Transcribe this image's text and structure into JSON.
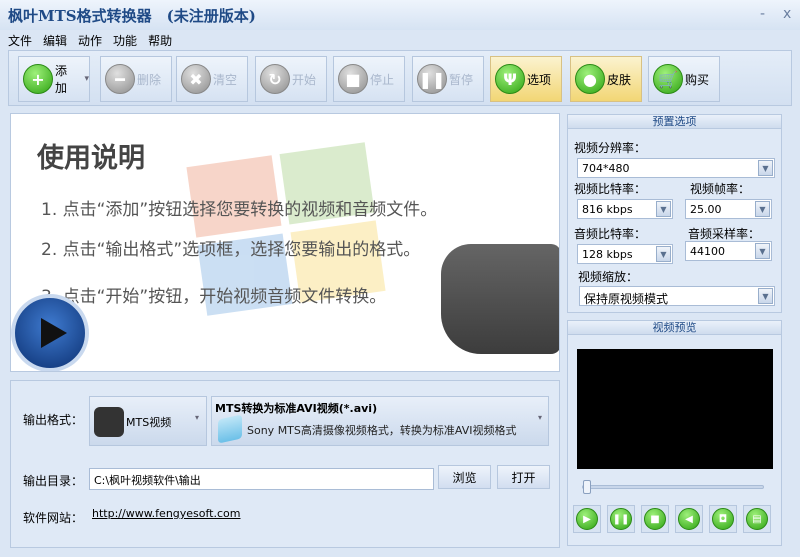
{
  "window": {
    "title": "枫叶MTS格式转换器　(未注册版本)",
    "minimize": "-",
    "close": "x"
  },
  "menu": [
    "文件",
    "编辑",
    "动作",
    "功能",
    "帮助"
  ],
  "toolbar": [
    {
      "label": "添加",
      "icon": "plus-icon",
      "glyph": "+",
      "enabled": true,
      "dropdown": "▾"
    },
    {
      "label": "删除",
      "icon": "minus-icon",
      "glyph": "━",
      "enabled": false
    },
    {
      "label": "清空",
      "icon": "clear-icon",
      "glyph": "✖",
      "enabled": false
    },
    {
      "label": "开始",
      "icon": "start-icon",
      "glyph": "↻",
      "enabled": false
    },
    {
      "label": "停止",
      "icon": "stop-icon",
      "glyph": "■",
      "enabled": false
    },
    {
      "label": "暂停",
      "icon": "pause-icon",
      "glyph": "❚❚",
      "enabled": false
    },
    {
      "label": "选项",
      "icon": "options-icon",
      "glyph": "Ψ",
      "enabled": true,
      "highlight": true
    },
    {
      "label": "皮肤",
      "icon": "skin-icon",
      "glyph": "●",
      "enabled": true,
      "highlight": true
    },
    {
      "label": "购买",
      "icon": "cart-icon",
      "glyph": "🛒",
      "enabled": true
    }
  ],
  "guide": {
    "title": "使用说明",
    "lines": [
      "1. 点击“添加”按钮选择您要转换的视频和音频文件。",
      "2. 点击“输出格式”选项框，选择您要输出的格式。",
      "3. 点击“开始”按钮，开始视频音频文件转换。"
    ]
  },
  "output": {
    "format_label": "输出格式：",
    "format_value": "MTS视频",
    "profile_title": "MTS转换为标准AVI视频(*.avi)",
    "profile_desc": "Sony MTS高清摄像视频格式，转换为标准AVI视频格式",
    "dir_label": "输出目录：",
    "dir_value": "C:\\枫叶视频软件\\输出",
    "browse": "浏览",
    "open": "打开",
    "site_label": "软件网站：",
    "site_url": "http://www.fengyesoft.com"
  },
  "preset": {
    "header": "预置选项",
    "resolution_label": "视频分辨率：",
    "resolution": "704*480",
    "vbitrate_label": "视频比特率：",
    "vbitrate": "816 kbps",
    "fps_label": "视频帧率：",
    "fps": "25.00",
    "abitrate_label": "音频比特率：",
    "abitrate": "128 kbps",
    "samplerate_label": "音频采样率：",
    "samplerate": "44100",
    "scale_label": "视频缩放：",
    "scale": "保持原视频模式"
  },
  "preview": {
    "header": "视频预览",
    "position": 0,
    "controls": [
      {
        "icon": "play-icon",
        "glyph": "▶"
      },
      {
        "icon": "pause-icon",
        "glyph": "❚❚"
      },
      {
        "icon": "stop-icon",
        "glyph": "■"
      },
      {
        "icon": "volume-icon",
        "glyph": "◀"
      },
      {
        "icon": "snapshot-icon",
        "glyph": "◘"
      },
      {
        "icon": "folder-icon",
        "glyph": "▤"
      }
    ]
  }
}
